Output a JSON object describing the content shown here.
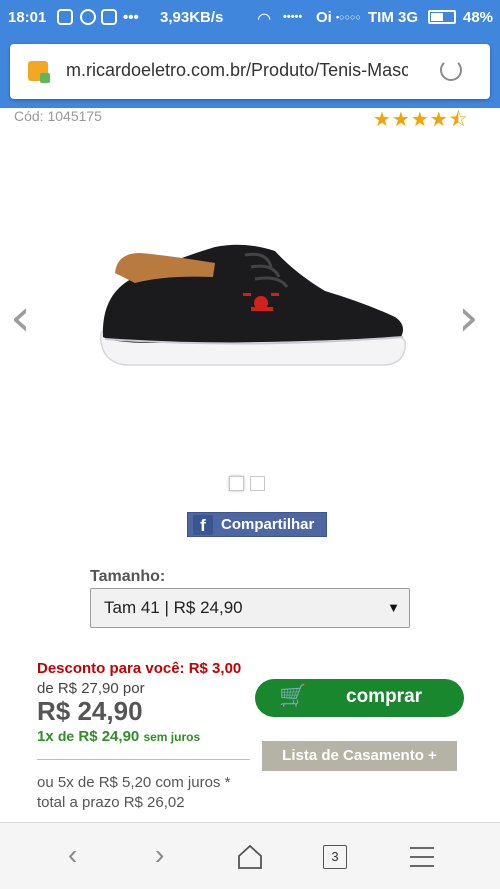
{
  "status_bar": {
    "time": "18:01",
    "network_speed": "3,93KB/s",
    "carrier_1": "Oi",
    "carrier_2": "TIM 3G",
    "battery": "48%"
  },
  "browser": {
    "url": "m.ricardoeletro.com.br/Produto/Tenis-Masc",
    "tab_count": "3"
  },
  "product": {
    "code": "Cód: 1045175",
    "rating_stars": "★★★★⯪",
    "rating_value": 4.5,
    "share_label": "Compartilhar",
    "image_dots_count": 2
  },
  "size": {
    "label": "Tamanho:",
    "selected": "Tam 41 | R$ 24,90"
  },
  "pricing": {
    "discount": "Desconto para você: R$ 3,00",
    "from_price": "de R$ 27,90 por",
    "price": "R$ 24,90",
    "installment_count": "1x",
    "installment_de": "de",
    "installment_value": "R$ 24,90",
    "installment_note": "sem juros",
    "juros_line1": "ou 5x de R$ 5,20 com juros *",
    "juros_line2": "total a prazo R$ 26,02"
  },
  "actions": {
    "buy_label": "comprar",
    "wedding_list_label": "Lista de Casamento +"
  },
  "colors": {
    "status_bar": "#3f86dc",
    "buy_button": "#19872d",
    "discount_text": "#c60000",
    "installment_text": "#2f8f26",
    "star": "#f5a300",
    "facebook": "#4e67a3"
  }
}
